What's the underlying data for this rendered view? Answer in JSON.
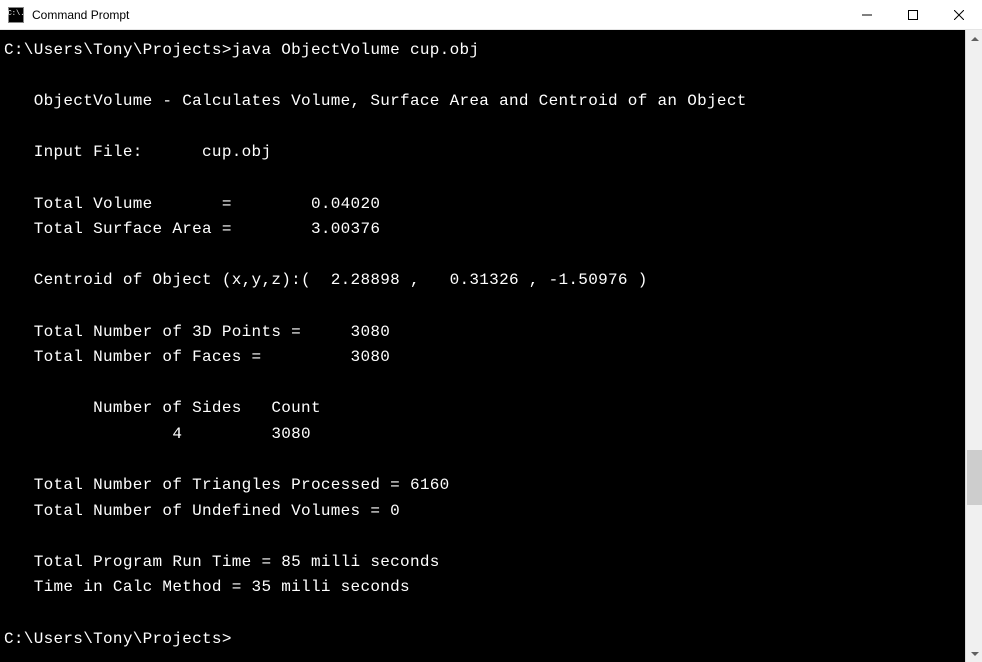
{
  "window": {
    "title": "Command Prompt",
    "icon_text": "C:\\."
  },
  "console": {
    "prompt1": "C:\\Users\\Tony\\Projects>",
    "command": "java ObjectVolume cup.obj",
    "blank": "",
    "header": "   ObjectVolume - Calculates Volume, Surface Area and Centroid of an Object",
    "input_file": "   Input File:      cup.obj",
    "volume": "   Total Volume       =        0.04020",
    "surface": "   Total Surface Area =        3.00376",
    "centroid": "   Centroid of Object (x,y,z):(  2.28898 ,   0.31326 , -1.50976 )",
    "points": "   Total Number of 3D Points =     3080",
    "faces": "   Total Number of Faces =         3080",
    "sides_header": "         Number of Sides   Count",
    "sides_row": "                 4         3080",
    "triangles": "   Total Number of Triangles Processed = 6160",
    "undefined_vol": "   Total Number of Undefined Volumes = 0",
    "runtime": "   Total Program Run Time = 85 milli seconds",
    "calctime": "   Time in Calc Method = 35 milli seconds",
    "prompt2": "C:\\Users\\Tony\\Projects>"
  }
}
